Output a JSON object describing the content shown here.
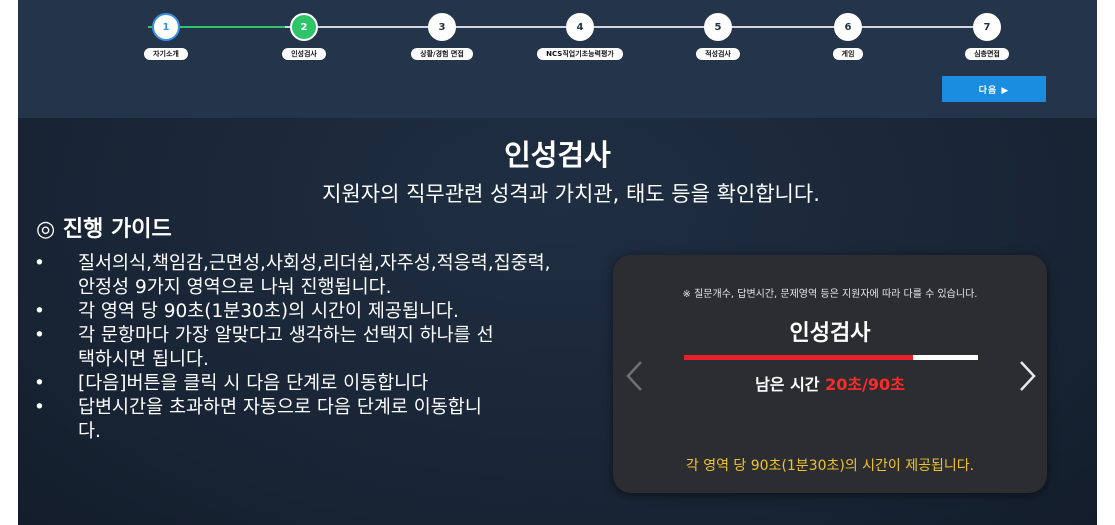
{
  "stepper": {
    "steps": [
      {
        "number": "1",
        "label": "자기소개"
      },
      {
        "number": "2",
        "label": "인성검사"
      },
      {
        "number": "3",
        "label": "상황/경험 면접"
      },
      {
        "number": "4",
        "label": "NCS직업기초능력평가"
      },
      {
        "number": "5",
        "label": "적성검사"
      },
      {
        "number": "6",
        "label": "게임"
      },
      {
        "number": "7",
        "label": "심층면접"
      }
    ],
    "current_step": 2
  },
  "next_button": {
    "label": "다음 ▶"
  },
  "page": {
    "title": "인성검사",
    "subtitle": "지원자의 직무관련 성격과 가치관, 태도 등을 확인합니다."
  },
  "guide": {
    "title": "◎ 진행 가이드",
    "bullet": "•",
    "items": [
      "질서의식,책임감,근면성,사회성,리더쉽,자주성,적응력,집중력,안정성 9가지 영역으로 나눠 진행됩니다.",
      "각 영역 당 90초(1분30초)의 시간이 제공됩니다.",
      "각 문항마다 가장 알맞다고 생각하는 선택지 하나를 선택하시면 됩니다.",
      "[다음]버튼을 클릭 시 다음 단계로 이동합니다",
      "답변시간을 초과하면 자동으로 다음 단계로 이동합니다."
    ]
  },
  "card": {
    "note": "※ 질문개수, 답변시간, 문제영역 등은 지원자에 따라 다를 수 있습니다.",
    "title": "인성검사",
    "remaining_label": "남은 시간 ",
    "remaining_time": "20초/90초",
    "progress_fraction": 0.78,
    "footer": "각 영역 당 90초(1분30초)의 시간이 제공됩니다."
  },
  "colors": {
    "accent_blue": "#1a8de0",
    "step_active": "#2ec46a",
    "timer_red": "#ff2a2a",
    "footer_yellow": "#f0c230"
  }
}
